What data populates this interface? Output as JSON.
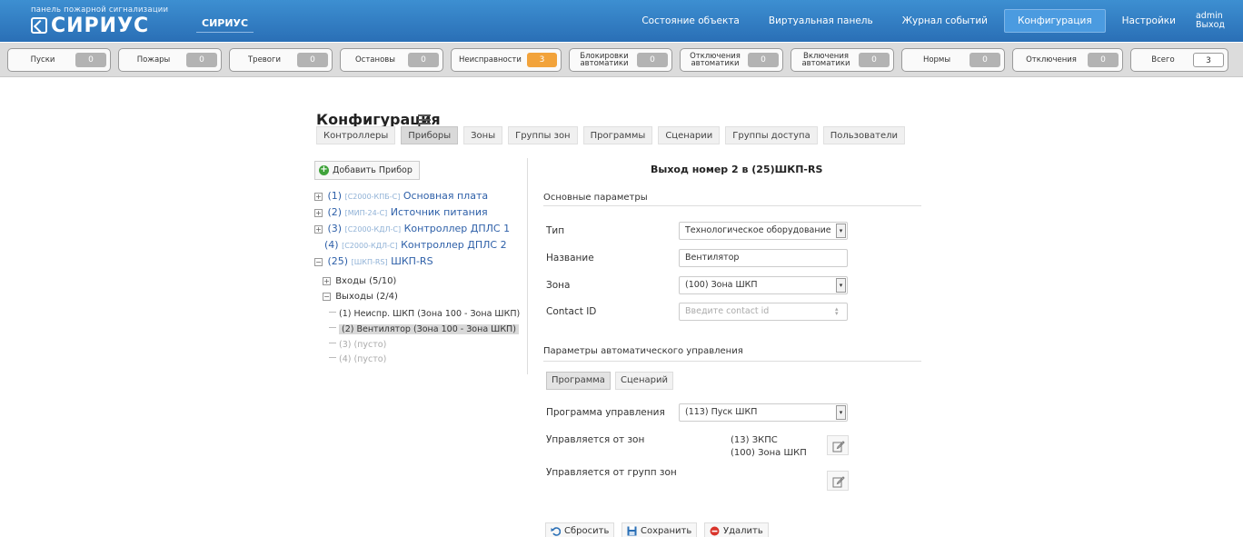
{
  "header": {
    "brand_subtitle": "панель пожарной сигнализации",
    "brand_logo": "СИРИУС",
    "product_tag": "СИРИУС",
    "nav": [
      {
        "label": "Состояние объекта",
        "active": false
      },
      {
        "label": "Виртуальная панель",
        "active": false
      },
      {
        "label": "Журнал событий",
        "active": false
      },
      {
        "label": "Конфигурация",
        "active": true
      },
      {
        "label": "Настройки",
        "active": false
      }
    ],
    "user": {
      "name": "admin",
      "logout": "Выход"
    }
  },
  "counters": [
    {
      "label": "Пуски",
      "value": "0"
    },
    {
      "label": "Пожары",
      "value": "0"
    },
    {
      "label": "Тревоги",
      "value": "0"
    },
    {
      "label": "Остановы",
      "value": "0"
    },
    {
      "label": "Неисправности",
      "value": "3"
    },
    {
      "label": "Блокировки автоматики",
      "value": "0"
    },
    {
      "label": "Отключения автоматики",
      "value": "0"
    },
    {
      "label": "Включения автоматики",
      "value": "0"
    },
    {
      "label": "Нормы",
      "value": "0"
    },
    {
      "label": "Отключения",
      "value": "0"
    },
    {
      "label": "Всего",
      "value": "3"
    }
  ],
  "page": {
    "title": "Конфигурация",
    "tabs": [
      "Контроллеры",
      "Приборы",
      "Зоны",
      "Группы зон",
      "Программы",
      "Сценарии",
      "Группы доступа",
      "Пользователи"
    ],
    "active_tab": "Приборы"
  },
  "tree": {
    "add_button": "Добавить Прибор",
    "devices": [
      {
        "num": "(1)",
        "type": "[С2000-КПБ-С]",
        "name": "Основная плата"
      },
      {
        "num": "(2)",
        "type": "[МИП-24-С]",
        "name": "Источник питания"
      },
      {
        "num": "(3)",
        "type": "[С2000-КДЛ-С]",
        "name": "Контроллер ДПЛС 1"
      },
      {
        "num": "(4)",
        "type": "[С2000-КДЛ-С]",
        "name": "Контроллер ДПЛС 2"
      },
      {
        "num": "(25)",
        "type": "[ШКП-RS]",
        "name": "ШКП-RS"
      }
    ],
    "inputs": "Входы (5/10)",
    "outputs": "Выходы (2/4)",
    "output_items": [
      "(1) Неиспр. ШКП (Зона 100 - Зона ШКП)",
      "(2) Вентилятор (Зона 100 - Зона ШКП)",
      "(3) (пусто)",
      "(4) (пусто)"
    ]
  },
  "detail": {
    "title": "Выход номер 2 в (25)ШКП-RS",
    "basic_section": "Основные параметры",
    "type_label": "Тип",
    "type_value": "Технологическое оборудование",
    "name_label": "Название",
    "name_value": "Вентилятор",
    "zone_label": "Зона",
    "zone_value": "(100) Зона ШКП",
    "contact_label": "Contact ID",
    "contact_placeholder": "Введите contact id",
    "auto_section": "Параметры автоматического управления",
    "subtabs": [
      "Программа",
      "Сценарий"
    ],
    "program_label": "Программа управления",
    "program_value": "(113) Пуск ШКП",
    "zones_label": "Управляется от зон",
    "zones": [
      "(13) ЗКПС",
      "(100) Зона ШКП"
    ],
    "zone_groups_label": "Управляется от групп зон"
  },
  "actions": {
    "reset": "Сбросить",
    "save": "Сохранить",
    "delete": "Удалить"
  },
  "colors": {
    "header": "#2a6fb6",
    "link": "#2d5fa8",
    "warning": "#f2a33b",
    "add_icon": "#3fa33a",
    "delete_icon": "#d9342b"
  }
}
